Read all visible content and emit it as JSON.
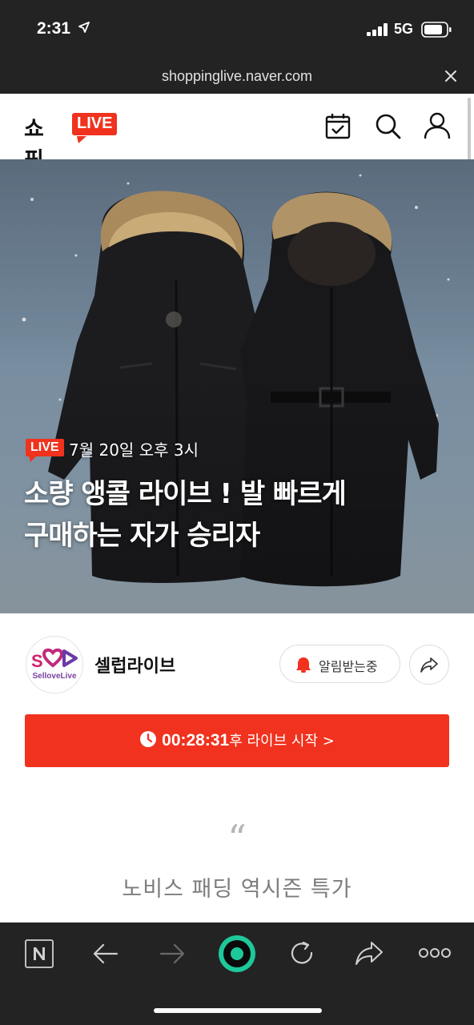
{
  "status_bar": {
    "time": "2:31",
    "network": "5G"
  },
  "url_bar": {
    "domain": "shoppinglive.naver.com"
  },
  "header": {
    "logo_text": "쇼핑",
    "logo_badge": "LIVE",
    "icons": [
      "calendar-check-icon",
      "search-icon",
      "user-icon"
    ]
  },
  "hero": {
    "badge": "LIVE",
    "date": "7월 20일 오후 3시",
    "title_line1": "소량 앵콜 라이브 ! 발 빠르게",
    "title_line2": "구매하는 자가 승리자"
  },
  "channel": {
    "avatar_text": "SelloveLive",
    "name": "셀럽라이브",
    "notify_label": "알림받는중"
  },
  "countdown": {
    "time": "00:28:31",
    "suffix": "후 라이브 시작 >"
  },
  "description": {
    "quote": "“",
    "text": "노비스 패딩 역시즌 특가"
  },
  "toolbar": {
    "icons": [
      "naver-n-icon",
      "back-arrow-icon",
      "forward-arrow-icon",
      "green-dot-icon",
      "refresh-icon",
      "share-icon",
      "more-icon"
    ]
  },
  "colors": {
    "accent": "#f0321e",
    "bars": "#232323",
    "green": "#1ec800"
  }
}
